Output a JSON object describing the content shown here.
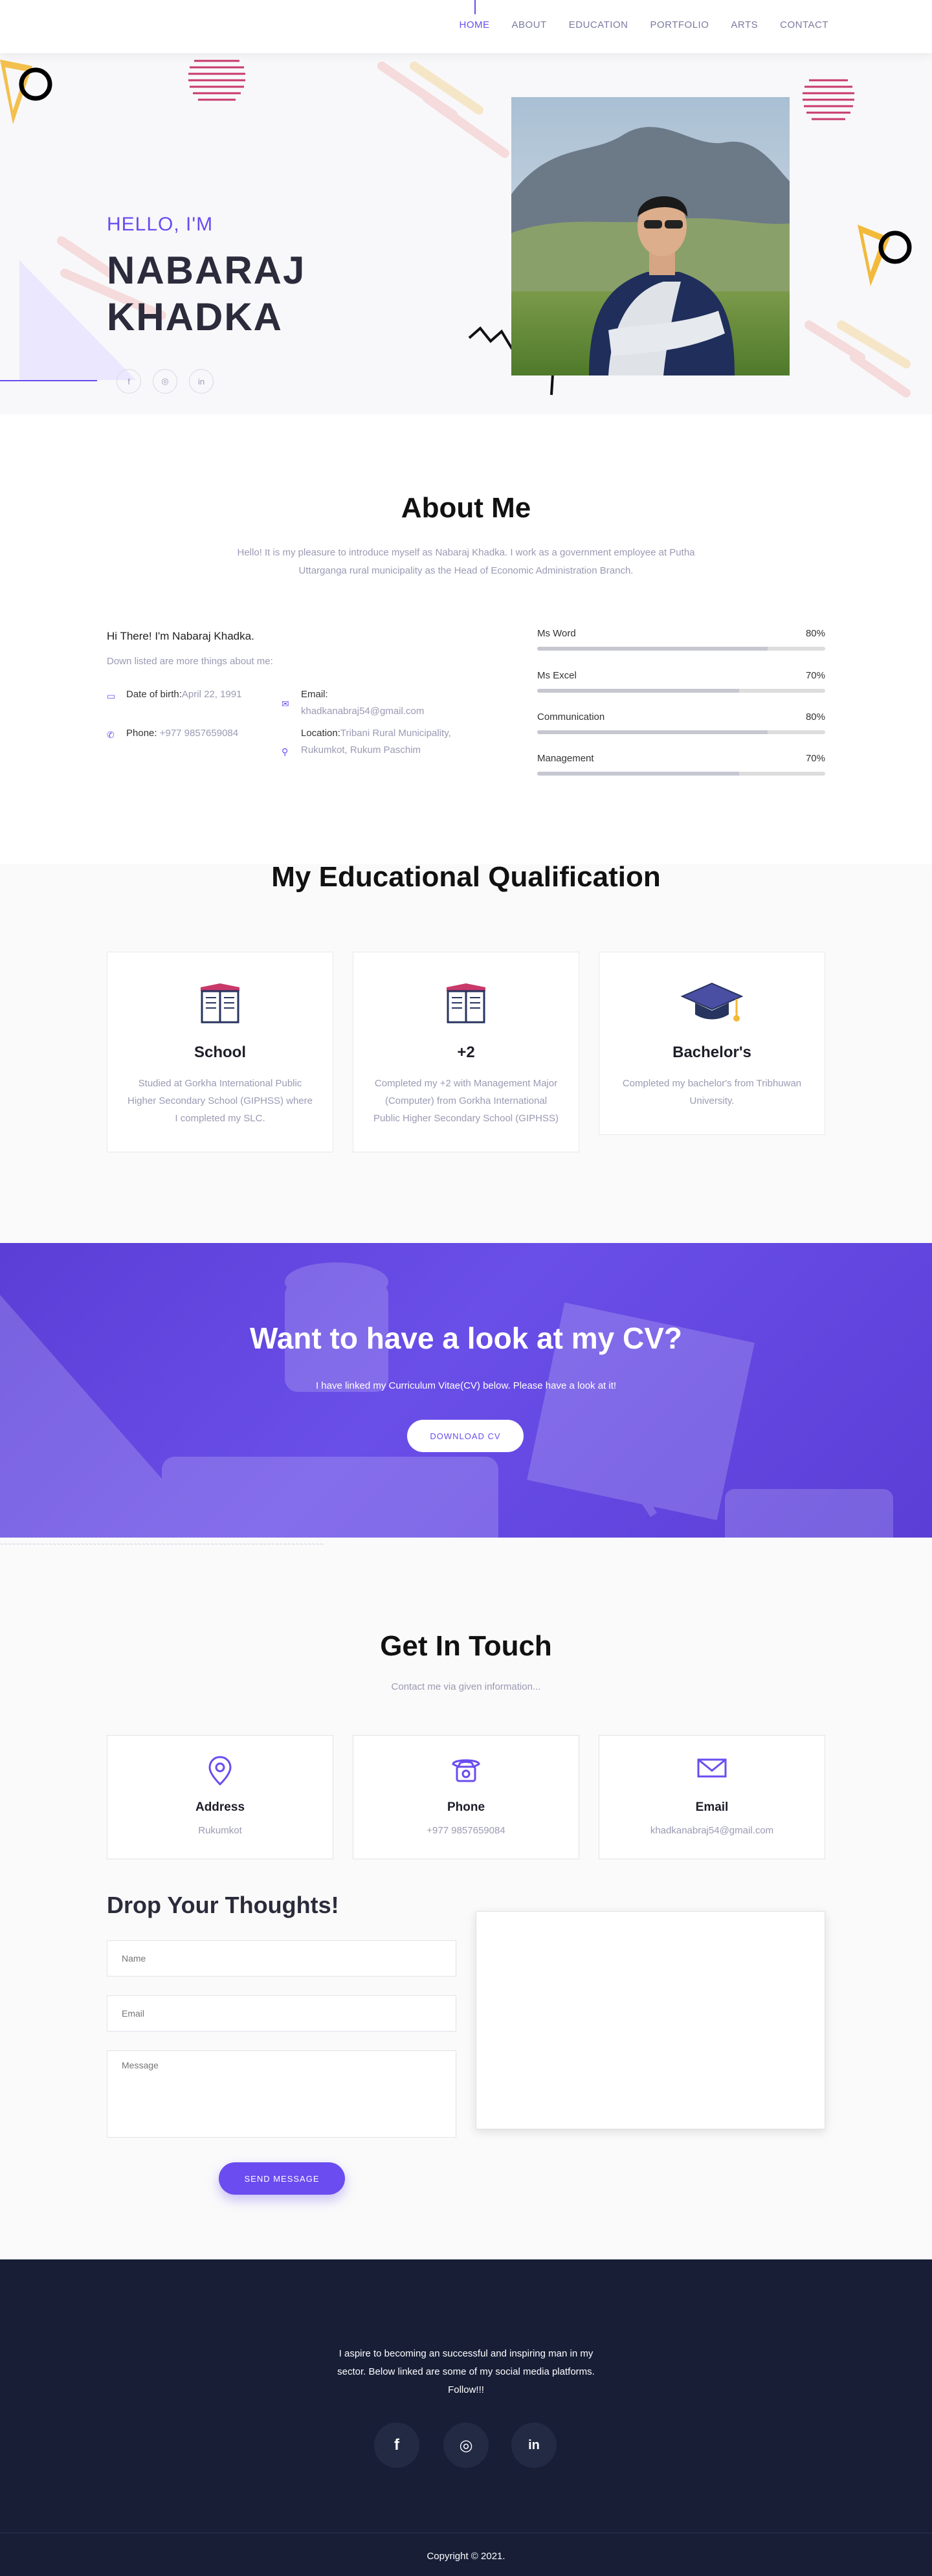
{
  "nav": {
    "items": [
      "HOME",
      "ABOUT",
      "EDUCATION",
      "PORTFOLIO",
      "ARTS",
      "CONTACT"
    ],
    "active_index": 0
  },
  "hero": {
    "greeting": "HELLO, I'M",
    "name_line1": "NABARAJ",
    "name_line2": "KHADKA",
    "social_icons": [
      "facebook-icon",
      "instagram-icon",
      "linkedin-icon"
    ],
    "social_glyphs": [
      "f",
      "◎",
      "in"
    ]
  },
  "about": {
    "title": "About Me",
    "description": "Hello! It is my pleasure to introduce myself as Nabaraj Khadka. I work as a government employee at Putha Uttarganga rural municipality as the Head of Economic Administration Branch.",
    "intro": "Hi There! I'm Nabaraj Khadka.",
    "subintro": "Down listed are more things about me:",
    "dob_label": "Date of birth:",
    "dob_value": "April 22, 1991",
    "phone_label": "Phone:",
    "phone_value": "+977 9857659084",
    "email_label": "Email:",
    "email_value": "khadkanabraj54@gmail.com",
    "location_label": "Location:",
    "location_value": "Tribani Rural Municipality, Rukumkot, Rukum Paschim",
    "skills": [
      {
        "name": "Ms Word",
        "percent": "80%",
        "value": 80
      },
      {
        "name": "Ms Excel",
        "percent": "70%",
        "value": 70
      },
      {
        "name": "Communication",
        "percent": "80%",
        "value": 80
      },
      {
        "name": "Management",
        "percent": "70%",
        "value": 70
      }
    ]
  },
  "education": {
    "title": "My Educational Qualification",
    "cards": [
      {
        "title": "School",
        "text": "Studied at Gorkha International Public Higher Secondary School (GIPHSS) where I completed my SLC.",
        "icon": "book-icon"
      },
      {
        "title": "+2",
        "text": "Completed my +2 with Management Major (Computer) from Gorkha International Public Higher Secondary School (GIPHSS)",
        "icon": "book-icon"
      },
      {
        "title": "Bachelor's",
        "text": "Completed my bachelor's from Tribhuwan University.",
        "icon": "graduation-cap-icon"
      }
    ]
  },
  "cv": {
    "title": "Want to have a look at my CV?",
    "subtitle": "I have linked my Curriculum Vitae(CV) below. Please have a look at it!",
    "button": "DOWNLOAD CV"
  },
  "contact": {
    "title": "Get In Touch",
    "subtitle": "Contact me via given information...",
    "cards": [
      {
        "title": "Address",
        "value": "Rukumkot",
        "icon": "location-pin-icon"
      },
      {
        "title": "Phone",
        "value": "+977 9857659084",
        "icon": "telephone-icon"
      },
      {
        "title": "Email",
        "value": "khadkanabraj54@gmail.com",
        "icon": "envelope-icon"
      }
    ],
    "form_title": "Drop Your Thoughts!",
    "name_placeholder": "Name",
    "email_placeholder": "Email",
    "message_placeholder": "Message",
    "send_button": "SEND MESSAGE"
  },
  "footer": {
    "text": "I aspire to becoming an successful and inspiring man in my sector. Below linked are some of my social media platforms. Follow!!!",
    "social_icons": [
      "facebook-icon",
      "instagram-icon",
      "linkedin-icon"
    ],
    "social_glyphs": [
      "f",
      "◎",
      "in"
    ],
    "copyright": "Copyright © 2021."
  },
  "colors": {
    "accent": "#6a4cf0",
    "footer_bg": "#171e36",
    "muted_text": "#9a9ab4"
  }
}
